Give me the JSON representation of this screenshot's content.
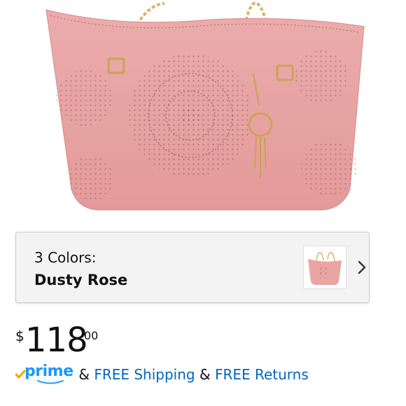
{
  "product": {
    "image_alt": "Pink perforated tote bag with gold chain handles",
    "colors": {
      "count_label": "3 Colors:",
      "selected_name": "Dusty Rose",
      "swatch_icon": "tote-bag-thumbnail",
      "chevron_icon": "chevron-right-icon"
    },
    "price": {
      "symbol": "$",
      "whole": "118",
      "fraction": "00"
    },
    "shipping": {
      "prime_label": "prime",
      "amp_1": "&",
      "free_shipping": "FREE Shipping",
      "amp_2": "&",
      "free_returns": "FREE Returns"
    }
  },
  "colors": {
    "bag": "#eaa4a4",
    "prime_blue": "#1a98ff",
    "prime_check": "#f0a500",
    "link_blue": "#0066c0"
  }
}
